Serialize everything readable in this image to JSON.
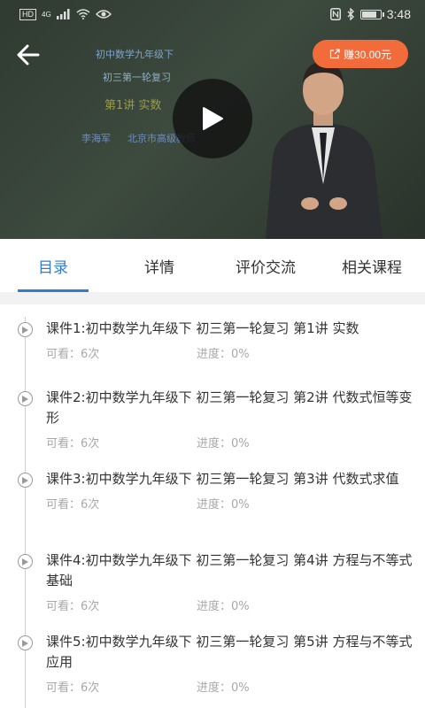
{
  "status": {
    "time": "3:48",
    "network": "4G",
    "hd": "HD",
    "battery_level": 0.85
  },
  "video": {
    "share_label": "赚30.00元",
    "slide": {
      "line1": "初中数学九年级下",
      "line2": "初三第一轮复习",
      "line3": "第1讲  实数",
      "teacher": "李海军",
      "school": "北京市高级教师"
    }
  },
  "tabs": [
    {
      "label": "目录",
      "active": true
    },
    {
      "label": "详情",
      "active": false
    },
    {
      "label": "评价交流",
      "active": false
    },
    {
      "label": "相关课程",
      "active": false
    }
  ],
  "items": [
    {
      "title": "课件1:初中数学九年级下 初三第一轮复习  第1讲 实数",
      "views": "可看：6次",
      "progress": "进度：0%"
    },
    {
      "title": "课件2:初中数学九年级下 初三第一轮复习  第2讲  代数式恒等变形",
      "views": "可看：6次",
      "progress": "进度：0%"
    },
    {
      "title": "课件3:初中数学九年级下 初三第一轮复习  第3讲  代数式求值",
      "views": "可看：6次",
      "progress": "进度：0%"
    },
    {
      "title": "课件4:初中数学九年级下 初三第一轮复习  第4讲  方程与不等式基础",
      "views": "可看：6次",
      "progress": "进度：0%"
    },
    {
      "title": "课件5:初中数学九年级下 初三第一轮复习  第5讲  方程与不等式应用",
      "views": "可看：6次",
      "progress": "进度：0%"
    }
  ]
}
